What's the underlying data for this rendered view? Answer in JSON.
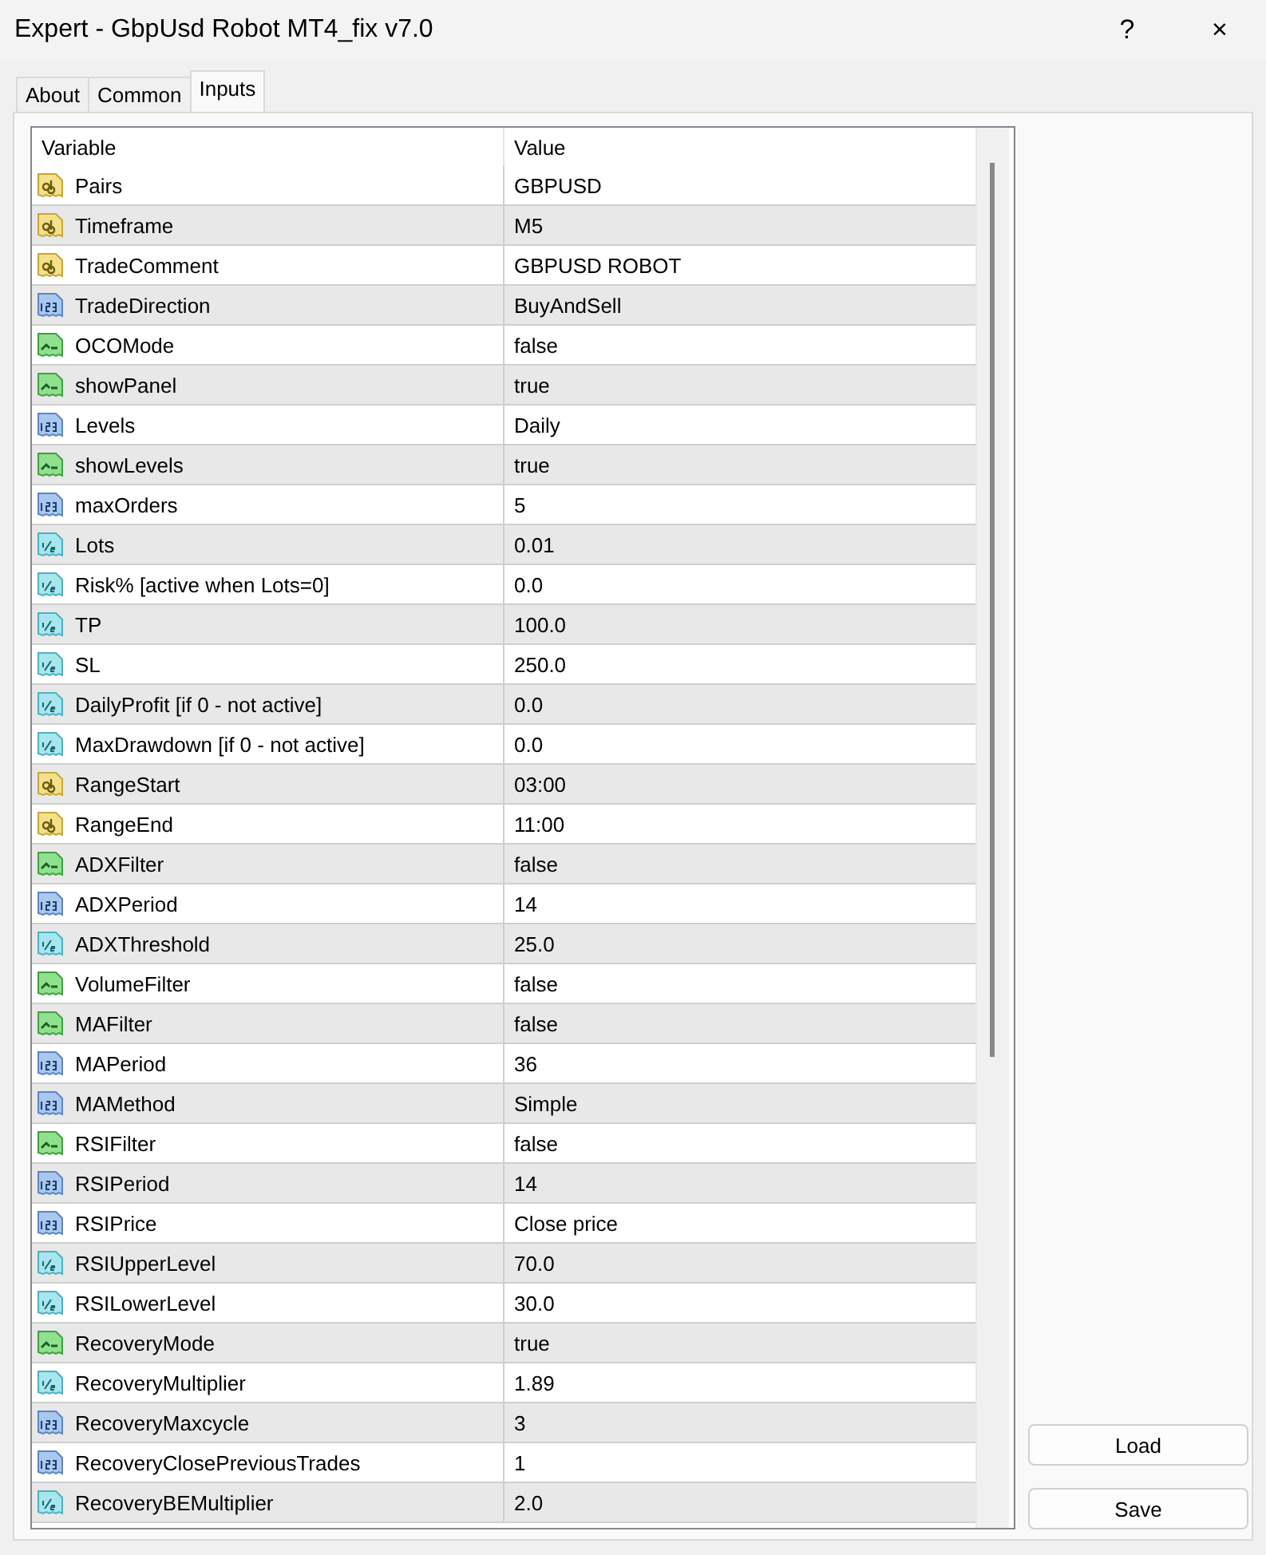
{
  "window": {
    "title": "Expert - GbpUsd Robot MT4_fix v7.0",
    "help": "?",
    "close": "×"
  },
  "tabs": [
    {
      "label": "About",
      "selected": false
    },
    {
      "label": "Common",
      "selected": false
    },
    {
      "label": "Inputs",
      "selected": true
    }
  ],
  "table": {
    "columns": [
      "Variable",
      "Value"
    ],
    "rows": [
      {
        "kind": "string",
        "variable": "Pairs",
        "value": "GBPUSD"
      },
      {
        "kind": "string",
        "variable": "Timeframe",
        "value": "M5"
      },
      {
        "kind": "string",
        "variable": "TradeComment",
        "value": "GBPUSD ROBOT"
      },
      {
        "kind": "integer",
        "variable": "TradeDirection",
        "value": "BuyAndSell"
      },
      {
        "kind": "boolean",
        "variable": "OCOMode",
        "value": "false"
      },
      {
        "kind": "boolean",
        "variable": "showPanel",
        "value": "true"
      },
      {
        "kind": "integer",
        "variable": "Levels",
        "value": "Daily"
      },
      {
        "kind": "boolean",
        "variable": "showLevels",
        "value": "true"
      },
      {
        "kind": "integer",
        "variable": "maxOrders",
        "value": "5"
      },
      {
        "kind": "double",
        "variable": "Lots",
        "value": "0.01"
      },
      {
        "kind": "double",
        "variable": "Risk% [active when Lots=0]",
        "value": "0.0"
      },
      {
        "kind": "double",
        "variable": "TP",
        "value": "100.0"
      },
      {
        "kind": "double",
        "variable": "SL",
        "value": "250.0"
      },
      {
        "kind": "double",
        "variable": "DailyProfit [if 0 - not active]",
        "value": "0.0"
      },
      {
        "kind": "double",
        "variable": "MaxDrawdown [if 0 - not active]",
        "value": "0.0"
      },
      {
        "kind": "string",
        "variable": "RangeStart",
        "value": "03:00"
      },
      {
        "kind": "string",
        "variable": "RangeEnd",
        "value": "11:00"
      },
      {
        "kind": "boolean",
        "variable": "ADXFilter",
        "value": "false"
      },
      {
        "kind": "integer",
        "variable": "ADXPeriod",
        "value": "14"
      },
      {
        "kind": "double",
        "variable": "ADXThreshold",
        "value": "25.0"
      },
      {
        "kind": "boolean",
        "variable": "VolumeFilter",
        "value": "false"
      },
      {
        "kind": "boolean",
        "variable": "MAFilter",
        "value": "false"
      },
      {
        "kind": "integer",
        "variable": "MAPeriod",
        "value": "36"
      },
      {
        "kind": "integer",
        "variable": "MAMethod",
        "value": "Simple"
      },
      {
        "kind": "boolean",
        "variable": "RSIFilter",
        "value": "false"
      },
      {
        "kind": "integer",
        "variable": "RSIPeriod",
        "value": "14"
      },
      {
        "kind": "integer",
        "variable": "RSIPrice",
        "value": "Close price"
      },
      {
        "kind": "double",
        "variable": "RSIUpperLevel",
        "value": "70.0"
      },
      {
        "kind": "double",
        "variable": "RSILowerLevel",
        "value": "30.0"
      },
      {
        "kind": "boolean",
        "variable": "RecoveryMode",
        "value": "true"
      },
      {
        "kind": "double",
        "variable": "RecoveryMultiplier",
        "value": "1.89"
      },
      {
        "kind": "integer",
        "variable": "RecoveryMaxcycle",
        "value": "3"
      },
      {
        "kind": "integer",
        "variable": "RecoveryClosePreviousTrades",
        "value": "1"
      },
      {
        "kind": "double",
        "variable": "RecoveryBEMultiplier",
        "value": "2.0"
      }
    ]
  },
  "buttons": [
    "Load",
    "Save"
  ]
}
